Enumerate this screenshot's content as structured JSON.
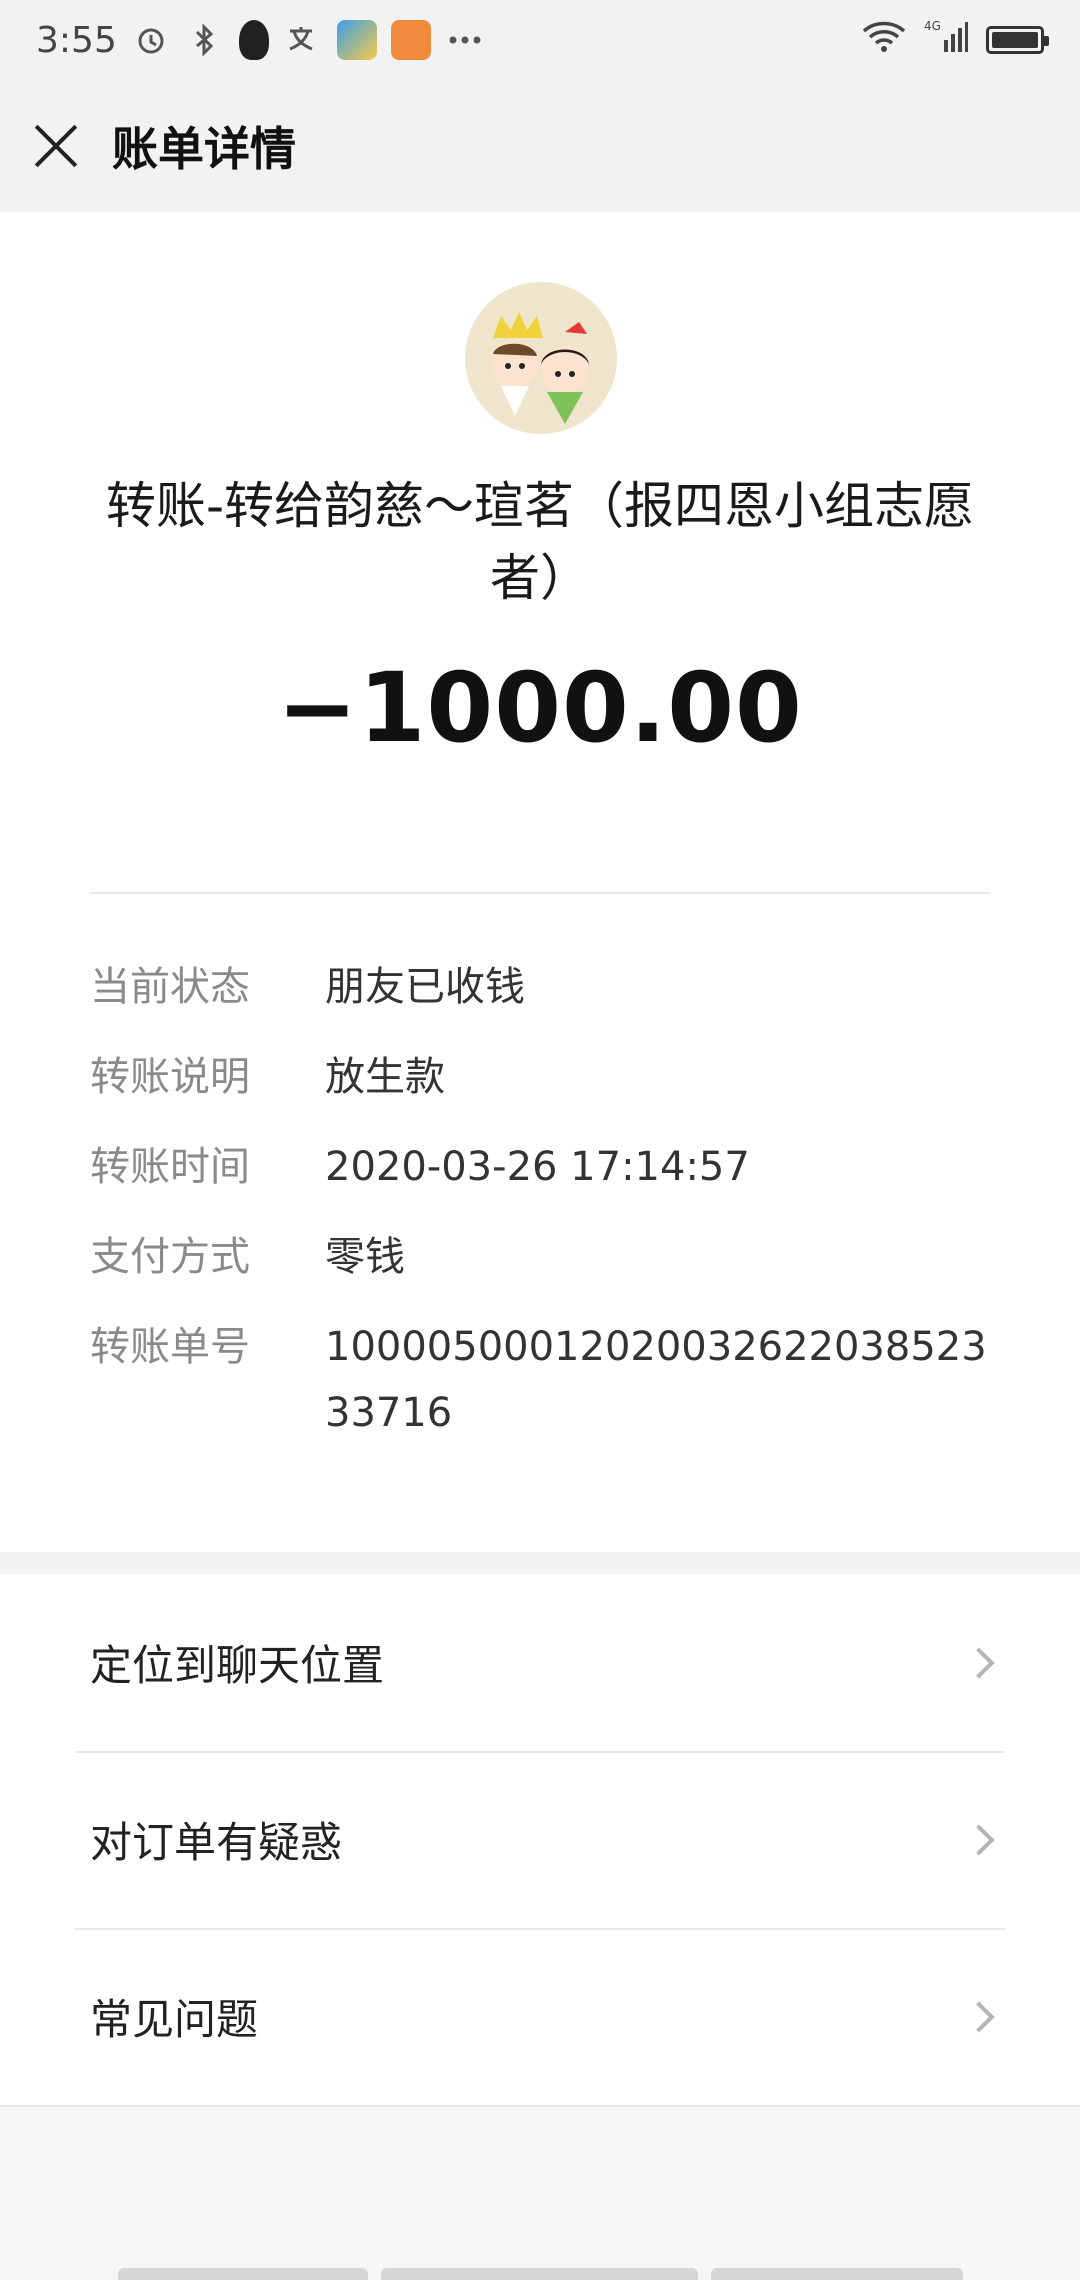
{
  "status_bar": {
    "time": "3:55",
    "icons": [
      "alarm-icon",
      "bluetooth-icon",
      "qq-icon",
      "translate-icon",
      "app-icon",
      "uc-browser-icon",
      "more-icon"
    ],
    "network": "4G"
  },
  "nav": {
    "title": "账单详情"
  },
  "transfer": {
    "title": "转账-转给韵慈～瑄茗（报四恩小组志愿者）",
    "amount": "−1000.00"
  },
  "details": [
    {
      "label": "当前状态",
      "value": "朋友已收钱"
    },
    {
      "label": "转账说明",
      "value": "放生款"
    },
    {
      "label": "转账时间",
      "value": "2020-03-26 17:14:57"
    },
    {
      "label": "支付方式",
      "value": "零钱"
    },
    {
      "label": "转账单号",
      "value": "1000050001202003262203852333716"
    }
  ],
  "menu": [
    {
      "label": "定位到聊天位置"
    },
    {
      "label": "对订单有疑惑"
    },
    {
      "label": "常见问题"
    }
  ],
  "colors": {
    "background": "#f6f6f6",
    "card": "#ffffff",
    "label": "#8a8a8a"
  }
}
